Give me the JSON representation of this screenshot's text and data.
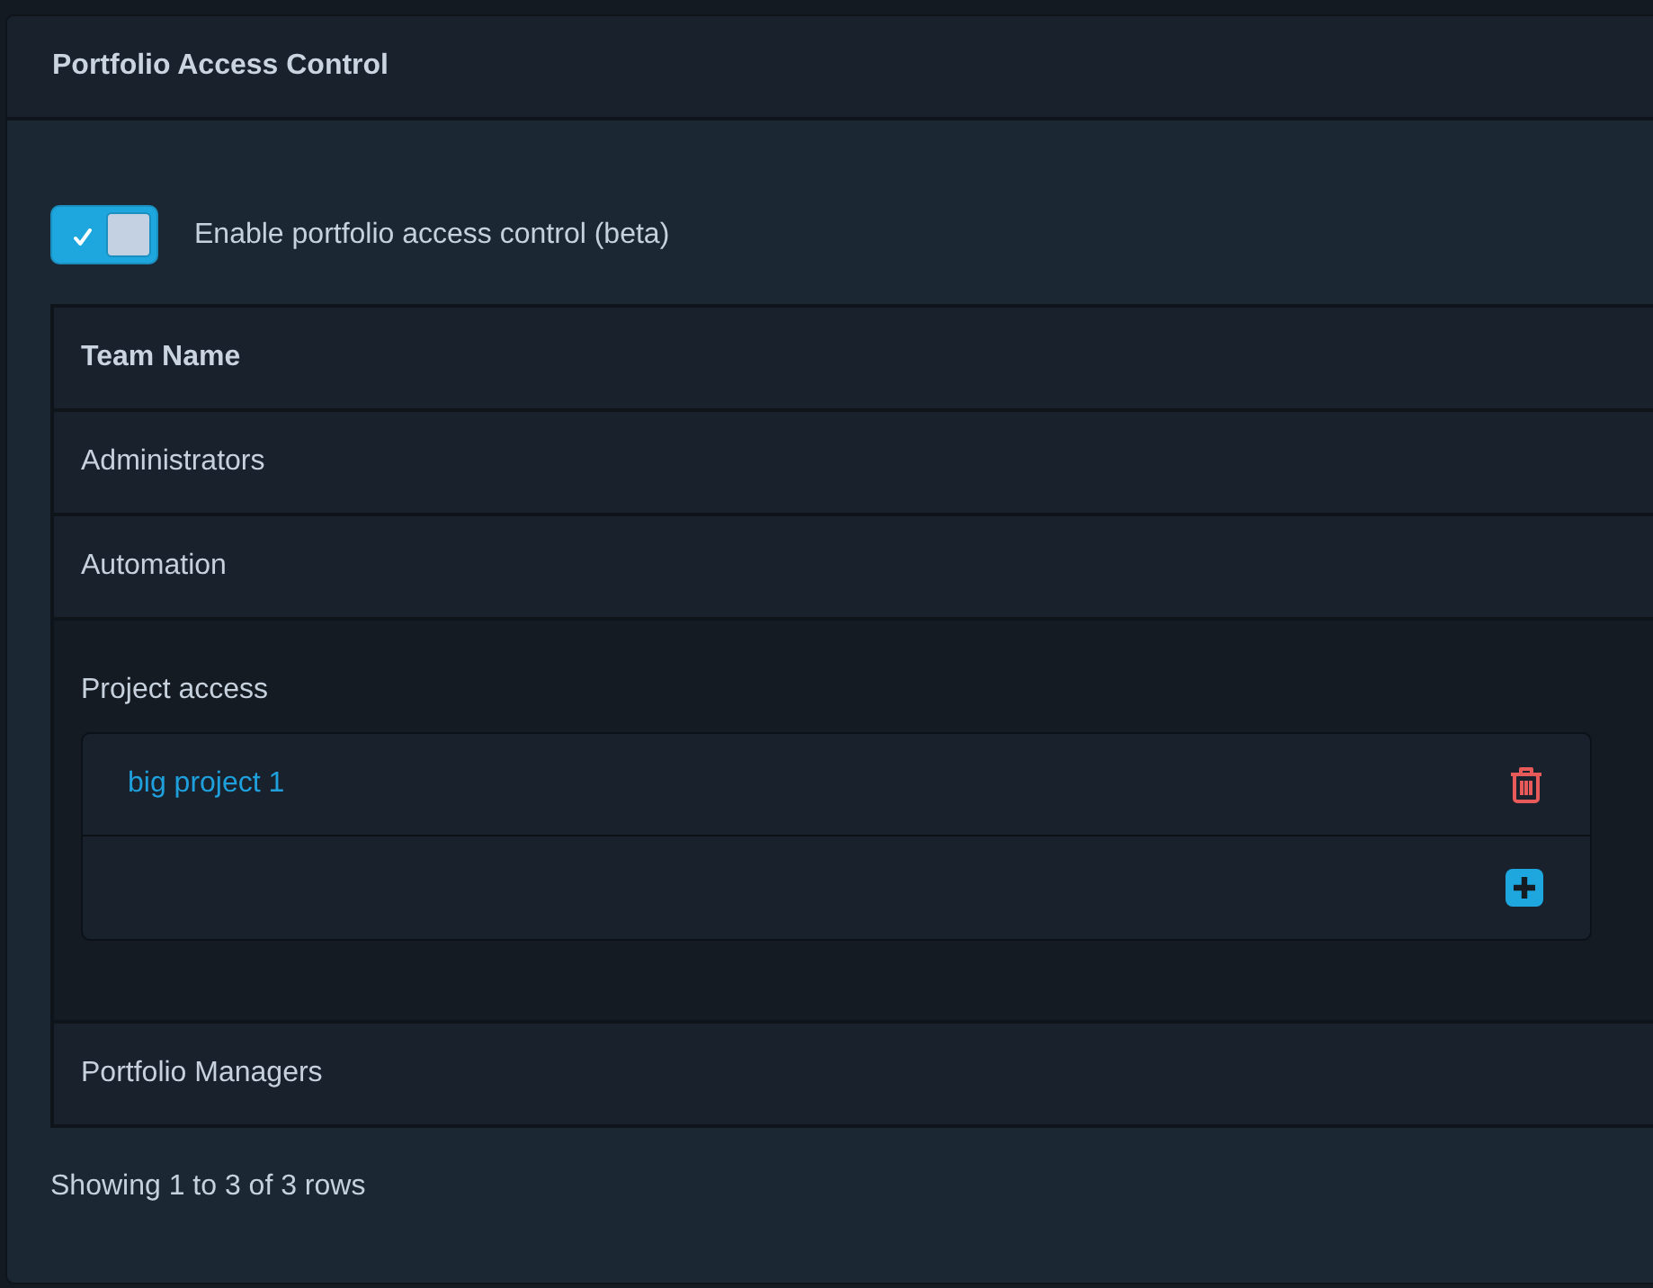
{
  "panel": {
    "title": "Portfolio Access Control"
  },
  "access_toggle": {
    "label": "Enable portfolio access control (beta)",
    "on": true
  },
  "teams_table": {
    "columns": [
      "Team Name"
    ],
    "rows": [
      {
        "name": "Administrators"
      },
      {
        "name": "Automation",
        "detail": {
          "heading": "Project access",
          "projects": [
            "big project 1"
          ]
        }
      },
      {
        "name": "Portfolio Managers"
      }
    ]
  },
  "footer": "Showing 1 to 3 of 3 rows"
}
